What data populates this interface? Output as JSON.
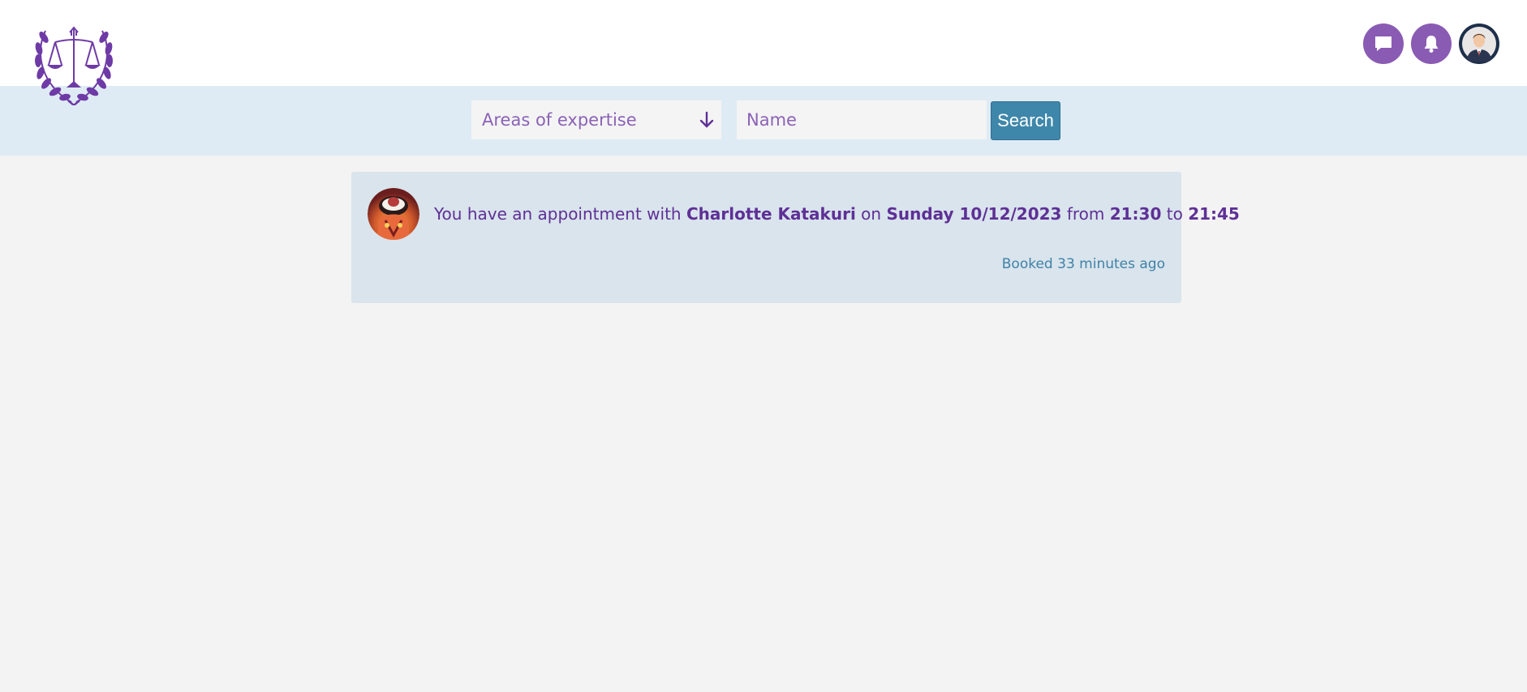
{
  "header": {
    "logo_icon": "scales-of-justice-laurel-logo",
    "actions": [
      {
        "icon": "chat-icon"
      },
      {
        "icon": "bell-icon"
      },
      {
        "icon": "user-avatar"
      }
    ]
  },
  "search": {
    "expertise_label": "Areas of expertise",
    "name_placeholder": "Name",
    "name_value": "",
    "search_label": "Search"
  },
  "notification": {
    "text_1": "You have an appointment with",
    "lawyer_name": "Charlotte Katakuri",
    "text_2": "on",
    "date": "Sunday 10/12/2023",
    "text_3": "from",
    "start_time": "21:30",
    "text_4": "to",
    "end_time": "21:45",
    "booked": "Booked 33 minutes ago"
  },
  "colors": {
    "accent_purple": "#8a5bb3",
    "text_purple": "#5e3096",
    "search_blue": "#3f87aa",
    "searchbar_bg": "#deebf4",
    "card_bg": "#d9e4ec"
  }
}
